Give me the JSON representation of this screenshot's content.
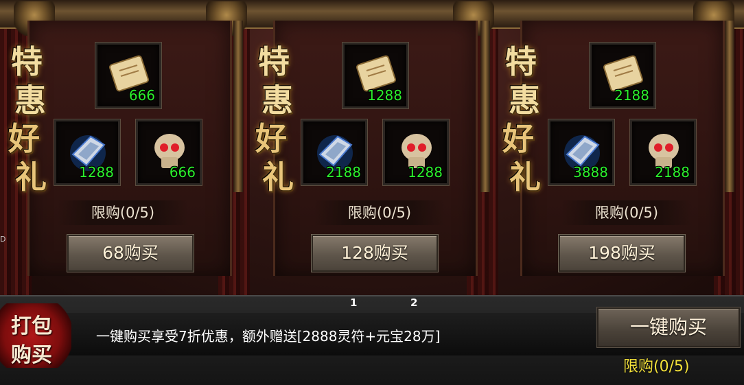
{
  "packs": [
    {
      "calligraphy": [
        "特",
        "惠",
        "好",
        "礼"
      ],
      "items": [
        {
          "icon": "scroll-icon",
          "count": "666"
        },
        {
          "icon": "crystal-icon",
          "count": "1288"
        },
        {
          "icon": "skull-icon",
          "count": "666"
        }
      ],
      "limit": "限购(0/5)",
      "buy_label": "68购买"
    },
    {
      "calligraphy": [
        "特",
        "惠",
        "好",
        "礼"
      ],
      "items": [
        {
          "icon": "scroll-icon",
          "count": "1288"
        },
        {
          "icon": "crystal-icon",
          "count": "2188"
        },
        {
          "icon": "skull-icon",
          "count": "1288"
        }
      ],
      "limit": "限购(0/5)",
      "buy_label": "128购买"
    },
    {
      "calligraphy": [
        "特",
        "惠",
        "好",
        "礼"
      ],
      "items": [
        {
          "icon": "scroll-icon",
          "count": "2188"
        },
        {
          "icon": "crystal-icon",
          "count": "3888"
        },
        {
          "icon": "skull-icon",
          "count": "2188"
        }
      ],
      "limit": "限购(0/5)",
      "buy_label": "198购买"
    }
  ],
  "side_marker": "D",
  "pager": [
    "1",
    "2"
  ],
  "bundle": {
    "badge": [
      "打包",
      "购买"
    ],
    "promo_text": "一键购买享受7折优惠，额外赠送[2888灵符+元宝28万]",
    "button_label": "一键购买",
    "limit": "限购(0/5)"
  },
  "colors": {
    "count_green": "#2cf02c",
    "limit_yellow": "#f3e13a",
    "badge_red": "#b01818",
    "calligraphy_gold": "#f2dca0"
  }
}
